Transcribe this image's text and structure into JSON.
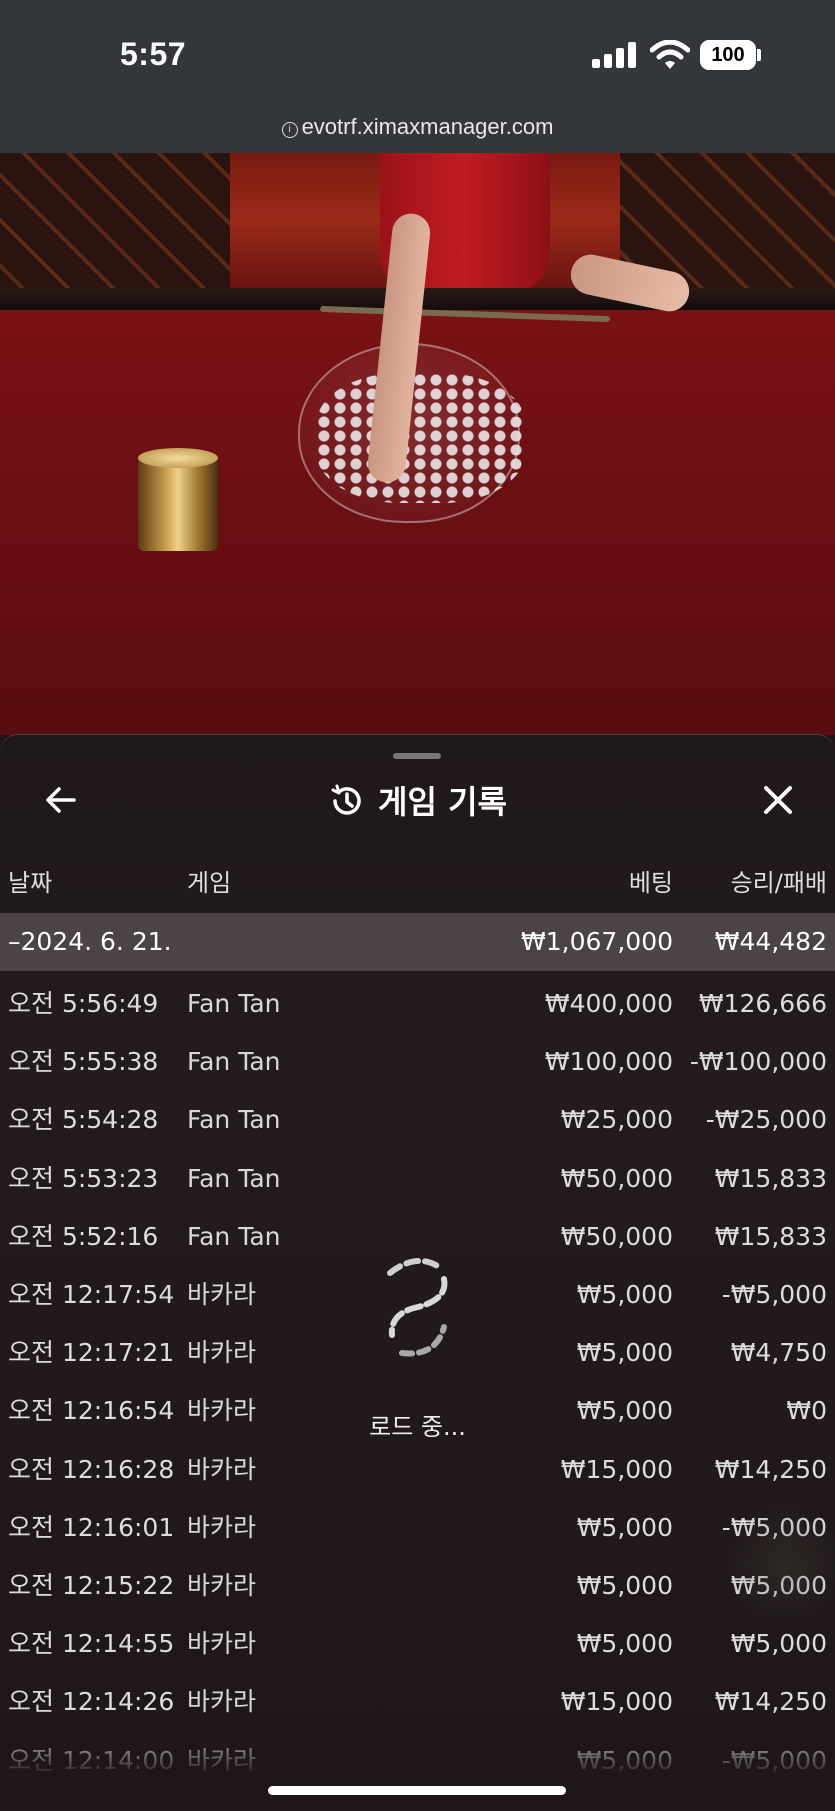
{
  "status_bar": {
    "time": "5:57",
    "battery": "100"
  },
  "browser": {
    "url": "evotrf.ximaxmanager.com"
  },
  "panel": {
    "title": "게임 기록",
    "columns": {
      "date": "날짜",
      "game": "게임",
      "bet": "베팅",
      "result": "승리/패배"
    },
    "summary": {
      "date": "–2024. 6. 21.",
      "bet": "₩1,067,000",
      "result": "₩44,482"
    },
    "rows": [
      {
        "time": "오전 5:56:49",
        "game": "Fan Tan",
        "bet": "₩400,000",
        "result": "₩126,666"
      },
      {
        "time": "오전 5:55:38",
        "game": "Fan Tan",
        "bet": "₩100,000",
        "result": "-₩100,000"
      },
      {
        "time": "오전 5:54:28",
        "game": "Fan Tan",
        "bet": "₩25,000",
        "result": "-₩25,000"
      },
      {
        "time": "오전 5:53:23",
        "game": "Fan Tan",
        "bet": "₩50,000",
        "result": "₩15,833"
      },
      {
        "time": "오전 5:52:16",
        "game": "Fan Tan",
        "bet": "₩50,000",
        "result": "₩15,833"
      },
      {
        "time": "오전 12:17:54",
        "game": "바카라",
        "bet": "₩5,000",
        "result": "-₩5,000"
      },
      {
        "time": "오전 12:17:21",
        "game": "바카라",
        "bet": "₩5,000",
        "result": "₩4,750"
      },
      {
        "time": "오전 12:16:54",
        "game": "바카라",
        "bet": "₩5,000",
        "result": "₩0"
      },
      {
        "time": "오전 12:16:28",
        "game": "바카라",
        "bet": "₩15,000",
        "result": "₩14,250"
      },
      {
        "time": "오전 12:16:01",
        "game": "바카라",
        "bet": "₩5,000",
        "result": "-₩5,000"
      },
      {
        "time": "오전 12:15:22",
        "game": "바카라",
        "bet": "₩5,000",
        "result": "₩5,000"
      },
      {
        "time": "오전 12:14:55",
        "game": "바카라",
        "bet": "₩5,000",
        "result": "₩5,000"
      },
      {
        "time": "오전 12:14:26",
        "game": "바카라",
        "bet": "₩15,000",
        "result": "₩14,250"
      },
      {
        "time": "오전 12:14:00",
        "game": "바카라",
        "bet": "₩5,000",
        "result": "-₩5,000"
      }
    ],
    "loading_text": "로드 중..."
  },
  "icons": {
    "back": "arrow-left-icon",
    "history": "history-icon",
    "close": "close-icon",
    "spinner": "loading-spinner-icon"
  }
}
